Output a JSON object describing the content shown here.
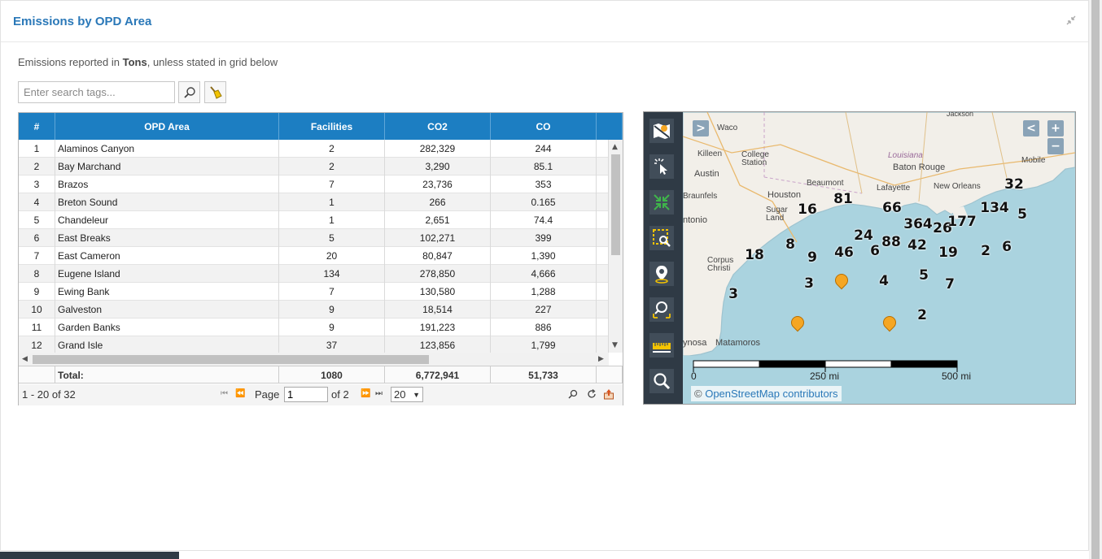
{
  "panel": {
    "title": "Emissions by OPD Area"
  },
  "subtitle": {
    "prefix": "Emissions reported in ",
    "unit": "Tons",
    "suffix": ", unless stated in grid below"
  },
  "search": {
    "placeholder": "Enter search tags..."
  },
  "grid": {
    "columns": [
      "#",
      "OPD Area",
      "Facilities",
      "CO2",
      "CO"
    ],
    "rows": [
      [
        "1",
        "Alaminos Canyon",
        "2",
        "282,329",
        "244"
      ],
      [
        "2",
        "Bay Marchand",
        "2",
        "3,290",
        "85.1"
      ],
      [
        "3",
        "Brazos",
        "7",
        "23,736",
        "353"
      ],
      [
        "4",
        "Breton Sound",
        "1",
        "266",
        "0.165"
      ],
      [
        "5",
        "Chandeleur",
        "1",
        "2,651",
        "74.4"
      ],
      [
        "6",
        "East Breaks",
        "5",
        "102,271",
        "399"
      ],
      [
        "7",
        "East Cameron",
        "20",
        "80,847",
        "1,390"
      ],
      [
        "8",
        "Eugene Island",
        "134",
        "278,850",
        "4,666"
      ],
      [
        "9",
        "Ewing Bank",
        "7",
        "130,580",
        "1,288"
      ],
      [
        "10",
        "Galveston",
        "9",
        "18,514",
        "227"
      ],
      [
        "11",
        "Garden Banks",
        "9",
        "191,223",
        "886"
      ],
      [
        "12",
        "Grand Isle",
        "37",
        "123,856",
        "1,799"
      ]
    ],
    "total": {
      "label": "Total:",
      "facilities": "1080",
      "co2": "6,772,941",
      "co": "51,733"
    },
    "pager": {
      "range": "1 - 20 of 32",
      "page_label": "Page",
      "page_value": "1",
      "of_label": "of 2",
      "page_size": "20"
    }
  },
  "map": {
    "nav_right": ">",
    "nav_left": "<",
    "zoom_in": "+",
    "zoom_out": "−",
    "cities": [
      "Waco",
      "Killeen",
      "College Station",
      "Louisiana",
      "Baton Rouge",
      "Mobile",
      "Austin",
      "Beaumont",
      "Lafayette",
      "New Orleans",
      "Houston",
      "Braunfels",
      "Sugar Land",
      "ntonio",
      "Corpus Christi",
      "ynosa",
      "Matamoros",
      "Jackson"
    ],
    "clusters": [
      "32",
      "81",
      "66",
      "16",
      "134",
      "5",
      "364",
      "26",
      "177",
      "24",
      "88",
      "42",
      "8",
      "46",
      "6",
      "19",
      "2",
      "6",
      "18",
      "9",
      "3",
      "4",
      "5",
      "7",
      "3",
      "2"
    ],
    "scale": {
      "zero": "0",
      "mid": "250 mi",
      "end": "500 mi"
    },
    "attribution": {
      "symbol": "© ",
      "link": "OpenStreetMap contributors"
    }
  }
}
